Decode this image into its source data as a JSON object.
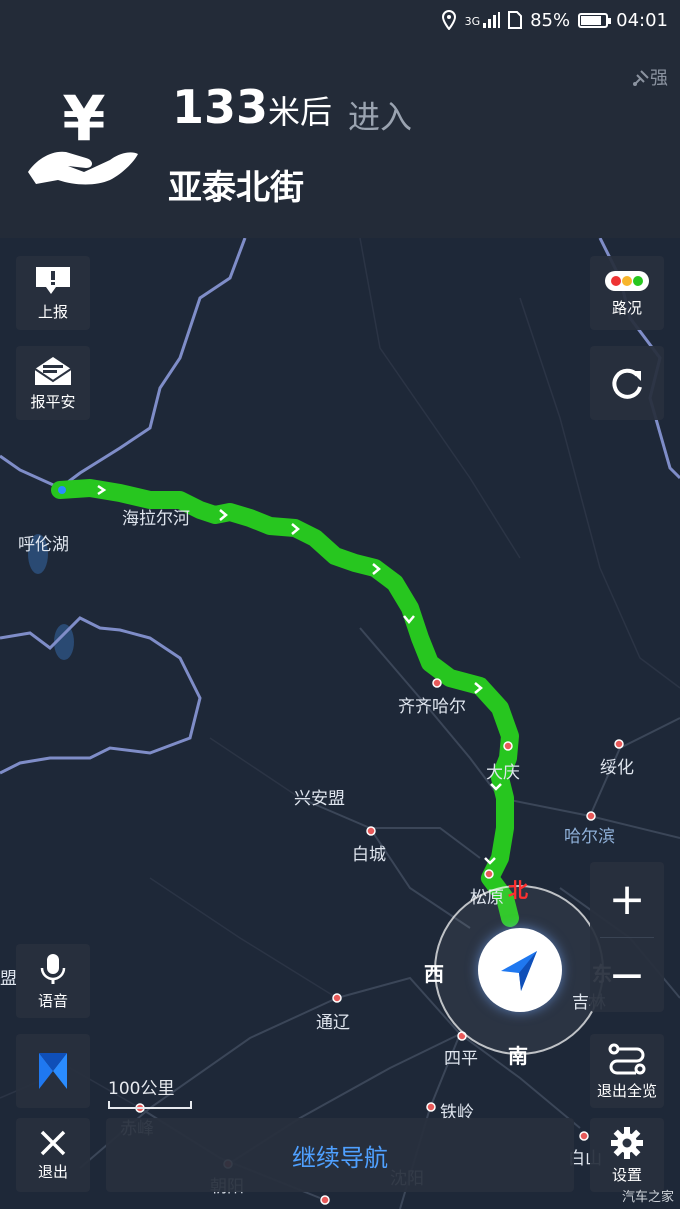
{
  "status_bar": {
    "network": "3G",
    "battery": "85%",
    "battery_level": 0.85,
    "time": "04:01"
  },
  "guidance": {
    "distance": "133",
    "distance_unit": "米后",
    "action": "进入",
    "road": "亚泰北街",
    "gps_strength": "强",
    "maneuver_icon": "toll-station-icon"
  },
  "left_buttons": {
    "report": "上报",
    "safe": "报平安",
    "voice": "语音",
    "exit": "退出"
  },
  "right_buttons": {
    "traffic": "路况",
    "overview": "退出全览",
    "settings": "设置",
    "zoom_in": "+",
    "zoom_out": "−"
  },
  "compass": {
    "north": "北",
    "west": "西",
    "east": "东",
    "south": "南"
  },
  "continue_nav": "继续导航",
  "scale": "100公里",
  "map_labels": {
    "hulun_lake": "呼伦湖",
    "hailar_river": "海拉尔河",
    "qiqihar": "齐齐哈尔",
    "daqing": "大庆",
    "suihua": "绥化",
    "xinganmeng": "兴安盟",
    "harbin": "哈尔滨",
    "baicheng": "白城",
    "songyuan": "松原",
    "jilin": "吉林",
    "meng": "盟",
    "tongliao": "通辽",
    "siping": "四平",
    "tieling": "铁岭",
    "chifeng": "赤峰",
    "chaoyang": "朝阳",
    "shenyang": "沈阳",
    "baishan": "白山"
  },
  "watermark": "汽车之家",
  "colors": {
    "route": "#27c61f",
    "background": "#1e2838",
    "accent": "#4fa0ff",
    "border_line": "#7f8dc8"
  }
}
